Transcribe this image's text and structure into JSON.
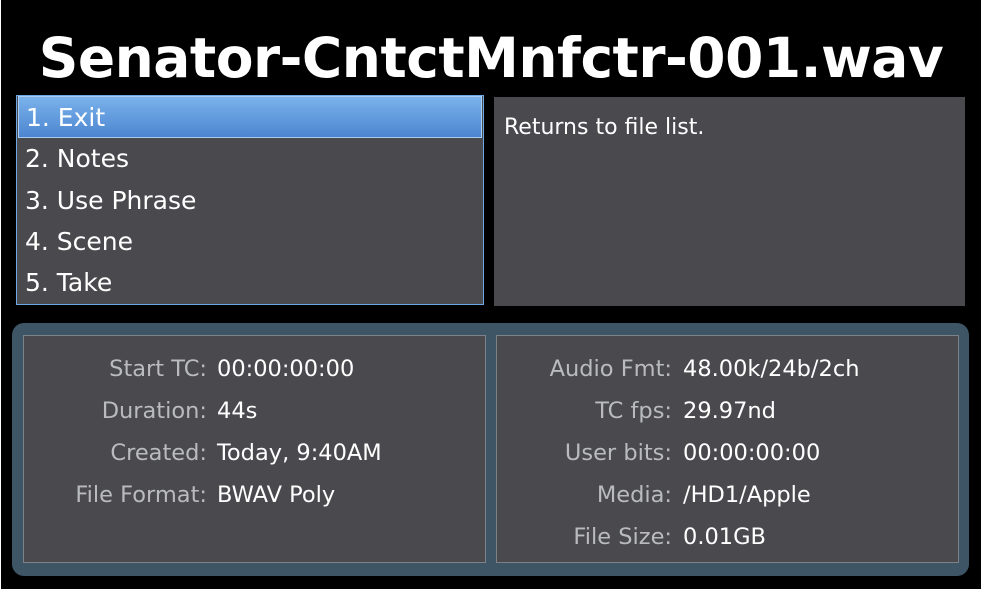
{
  "title": "Senator-CntctMnfctr-001.wav",
  "menu": {
    "items": [
      {
        "label": "1. Exit",
        "selected": true
      },
      {
        "label": "2. Notes",
        "selected": false
      },
      {
        "label": "3. Use Phrase",
        "selected": false
      },
      {
        "label": "4. Scene",
        "selected": false
      },
      {
        "label": "5. Take",
        "selected": false
      }
    ]
  },
  "description": "Returns to file list.",
  "info": {
    "left": [
      {
        "label": "Start TC:",
        "value": "00:00:00:00"
      },
      {
        "label": "Duration:",
        "value": "44s"
      },
      {
        "label": "Created:",
        "value": "Today, 9:40AM"
      },
      {
        "label": "File Format:",
        "value": "BWAV Poly"
      }
    ],
    "right": [
      {
        "label": "Audio Fmt:",
        "value": "48.00k/24b/2ch"
      },
      {
        "label": "TC fps:",
        "value": "29.97nd"
      },
      {
        "label": "User bits:",
        "value": "00:00:00:00"
      },
      {
        "label": "Media:",
        "value": "/HD1/Apple"
      },
      {
        "label": "File Size:",
        "value": "0.01GB"
      }
    ]
  },
  "colors": {
    "background": "#000000",
    "panel": "#4a4a4e",
    "selection": "#5a93d8",
    "frame": "#3d5565",
    "label": "#b9bbbe",
    "value": "#ffffff"
  }
}
